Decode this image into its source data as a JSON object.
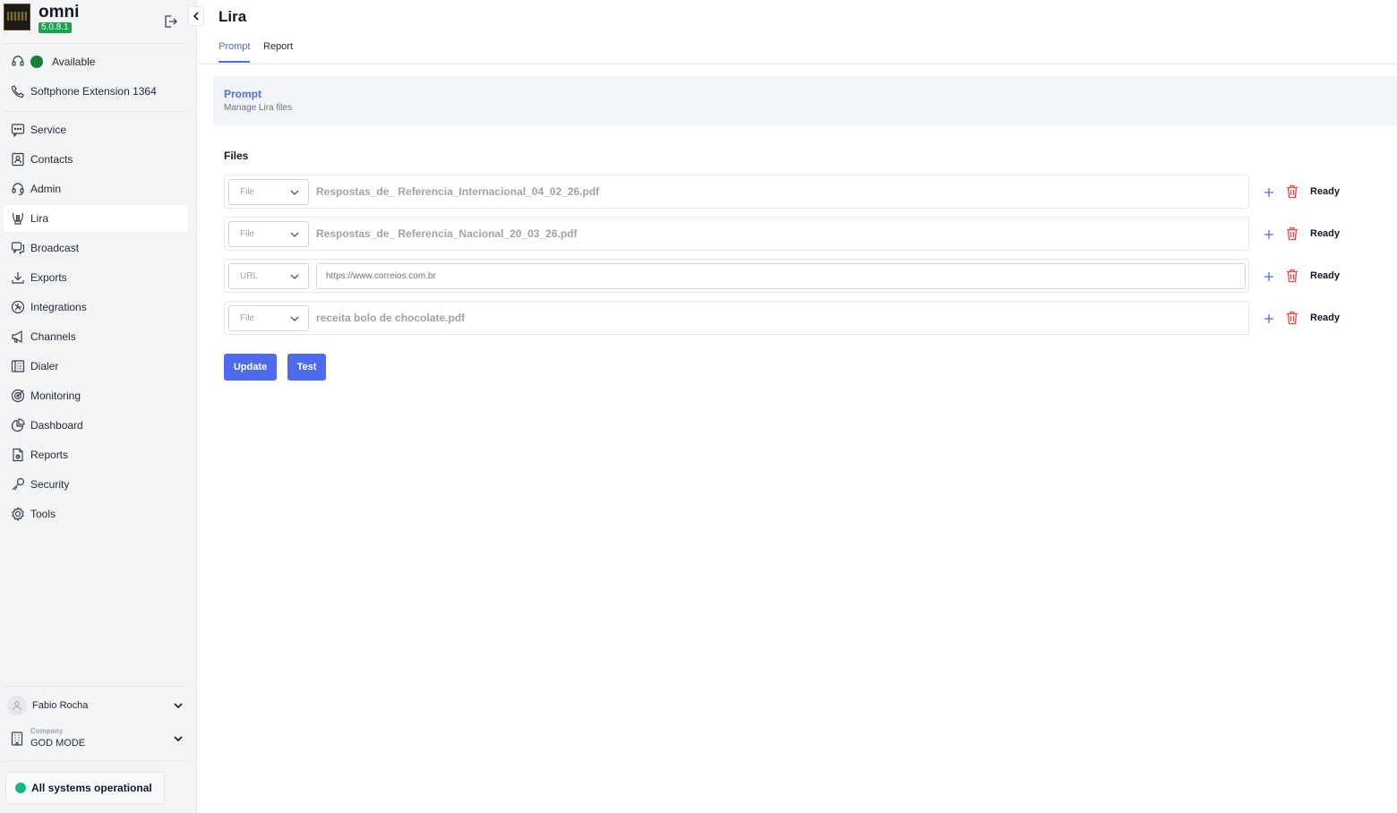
{
  "brand": {
    "name": "omni",
    "version": "5.0.8.1"
  },
  "presence": {
    "status": "Available",
    "extension": "Softphone Extension 1364"
  },
  "nav": [
    {
      "label": "Service",
      "icon": "chat-icon"
    },
    {
      "label": "Contacts",
      "icon": "contact-card-icon"
    },
    {
      "label": "Admin",
      "icon": "headset-icon"
    },
    {
      "label": "Lira",
      "icon": "lyre-icon"
    },
    {
      "label": "Broadcast",
      "icon": "broadcast-icon"
    },
    {
      "label": "Exports",
      "icon": "download-icon"
    },
    {
      "label": "Integrations",
      "icon": "integrations-icon"
    },
    {
      "label": "Channels",
      "icon": "megaphone-icon"
    },
    {
      "label": "Dialer",
      "icon": "dialer-icon"
    },
    {
      "label": "Monitoring",
      "icon": "target-icon"
    },
    {
      "label": "Dashboard",
      "icon": "pie-chart-icon"
    },
    {
      "label": "Reports",
      "icon": "report-icon"
    },
    {
      "label": "Security",
      "icon": "key-icon"
    },
    {
      "label": "Tools",
      "icon": "gear-icon"
    }
  ],
  "active_nav": "Lira",
  "user": {
    "name": "Fabio Rocha"
  },
  "company": {
    "label": "Company",
    "value": "GOD MODE"
  },
  "system_status": "All systems operational",
  "page": {
    "title": "Lira",
    "tabs": [
      "Prompt",
      "Report"
    ],
    "active_tab": "Prompt",
    "panel": {
      "title": "Prompt",
      "subtitle": "Manage Lira files"
    },
    "files_label": "Files",
    "files": [
      {
        "type": "File",
        "value": "Respostas_de_ Referencia_Internacional_04_02_26.pdf",
        "status": "Ready"
      },
      {
        "type": "File",
        "value": "Respostas_de_ Referencia_Nacional_20_03_26.pdf",
        "status": "Ready"
      },
      {
        "type": "URL",
        "value": "",
        "placeholder": "https://www.correios.com.br",
        "status": "Ready"
      },
      {
        "type": "File",
        "value": "receita bolo de chocolate.pdf",
        "status": "Ready"
      }
    ],
    "buttons": {
      "update": "Update",
      "test": "Test"
    }
  },
  "colors": {
    "accent": "#4f6bed",
    "available": "#15803d",
    "operational": "#10b981",
    "danger": "#ef4444",
    "version_badge": "#16a34a"
  }
}
